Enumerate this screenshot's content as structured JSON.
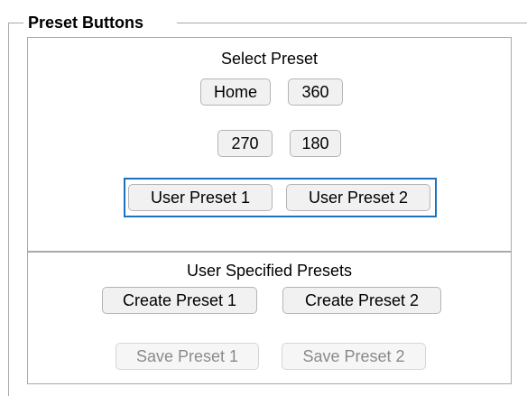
{
  "fieldset": {
    "legend": "Preset Buttons"
  },
  "select_preset": {
    "title": "Select Preset",
    "buttons": {
      "home": "Home",
      "p360": "360",
      "p270": "270",
      "p180": "180",
      "user1": "User Preset 1",
      "user2": "User Preset 2"
    }
  },
  "user_presets": {
    "title": "User Specified Presets",
    "create1": "Create Preset 1",
    "create2": "Create Preset 2",
    "save1": "Save Preset 1",
    "save2": "Save Preset 2",
    "save_enabled": false
  },
  "colors": {
    "focus_outline": "#1a72bd",
    "border": "#a9a9a9"
  }
}
